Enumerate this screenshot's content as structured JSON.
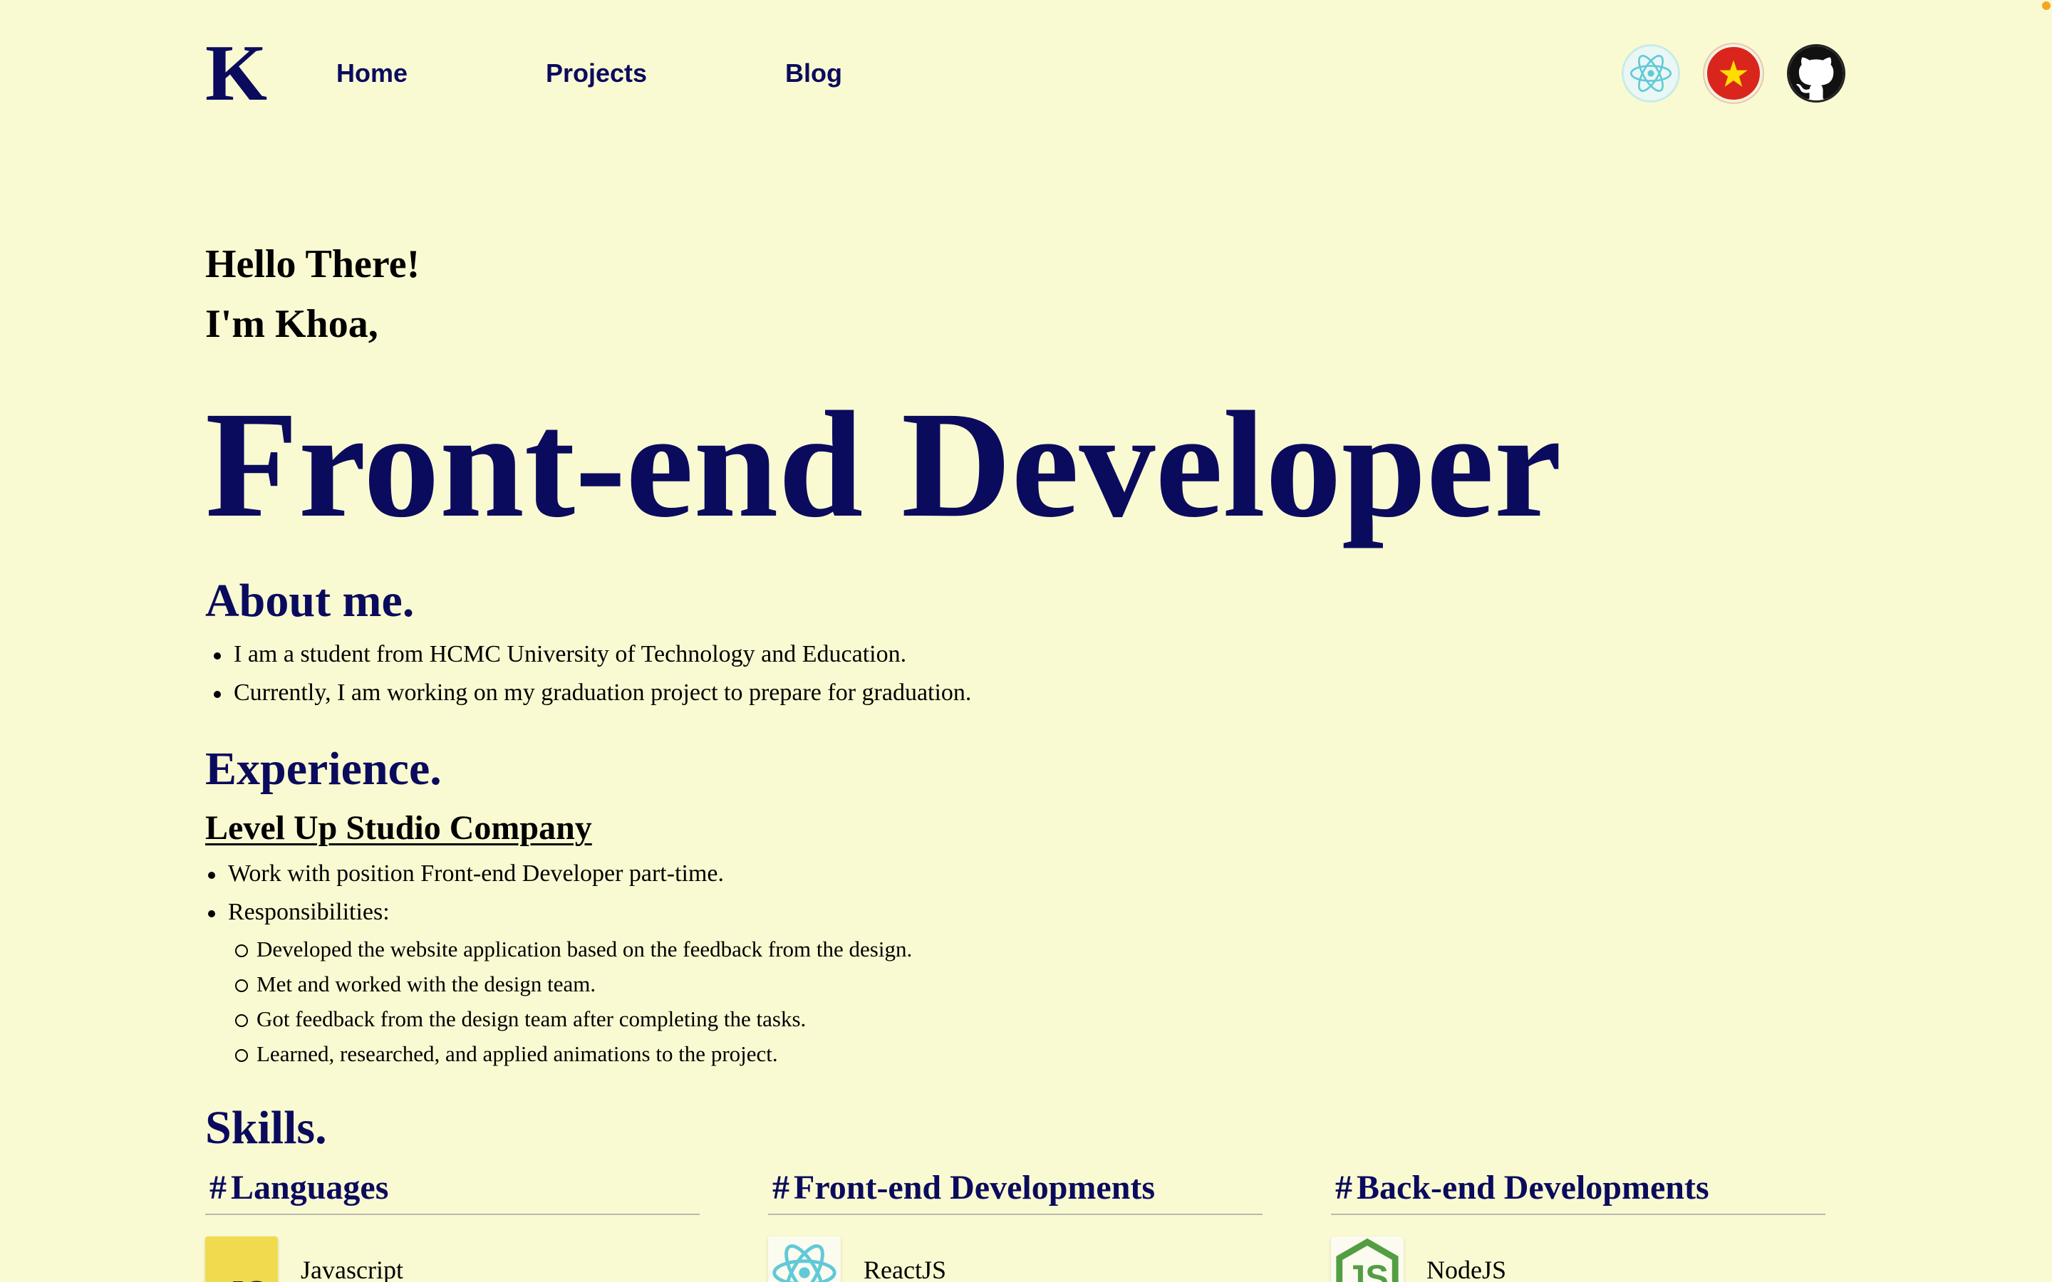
{
  "header": {
    "logo": "K",
    "nav": {
      "home": "Home",
      "projects": "Projects",
      "blog": "Blog"
    },
    "icons": [
      "react-icon",
      "vietnam-flag-icon",
      "github-icon"
    ]
  },
  "hero": {
    "greeting_1": "Hello There!",
    "greeting_2": "I'm Khoa,",
    "title": "Front-end Developer"
  },
  "about": {
    "heading": "About me.",
    "items": [
      "I am a student from HCMC University of Technology and Education.",
      "Currently, I am working on my graduation project to prepare for graduation."
    ]
  },
  "experience": {
    "heading": "Experience.",
    "company": "Level Up Studio Company",
    "items": [
      "Work with position Front-end Developer part-time.",
      "Responsibilities:"
    ],
    "responsibilities": [
      "Developed the website application based on the feedback from the design.",
      "Met and worked with the design team.",
      "Got feedback from the design team after completing the tasks.",
      "Learned, researched, and applied animations to the project."
    ]
  },
  "skills": {
    "heading": "Skills.",
    "hash": "#",
    "columns": [
      {
        "title": "Languages",
        "item": "Javascript",
        "logo_text": "JS"
      },
      {
        "title": "Front-end Developments",
        "item": "ReactJS"
      },
      {
        "title": "Back-end Developments",
        "item": "NodeJS"
      }
    ]
  },
  "colors": {
    "background": "#fafad2",
    "accent": "#0b0b5e"
  }
}
